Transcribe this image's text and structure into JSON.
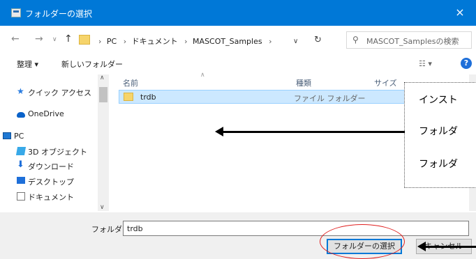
{
  "window": {
    "title": "フォルダーの選択",
    "close_label": "×"
  },
  "address": {
    "crumbs": [
      "PC",
      "ドキュメント",
      "MASCOT_Samples"
    ],
    "dropdown_glyph": "∨",
    "refresh_glyph": "↻",
    "search_placeholder": "MASCOT_Samplesの検索"
  },
  "nav_buttons": {
    "back": "←",
    "forward": "→",
    "recent": "∨",
    "up": "↑"
  },
  "commands": {
    "organize": "整理 ▾",
    "new_folder": "新しいフォルダー",
    "view": "☷ ▾",
    "help": "?"
  },
  "sidebar": {
    "items": [
      {
        "label": "クイック アクセス",
        "icon": "star-icon"
      },
      {
        "label": "OneDrive",
        "icon": "cloud-icon"
      },
      {
        "label": "PC",
        "icon": "computer-icon"
      },
      {
        "label": "3D オブジェクト",
        "icon": "cube-icon"
      },
      {
        "label": "ダウンロード",
        "icon": "download-icon"
      },
      {
        "label": "デスクトップ",
        "icon": "desktop-icon"
      },
      {
        "label": "ドキュメント",
        "icon": "document-icon"
      }
    ]
  },
  "columns": {
    "name": "名前",
    "type": "種類",
    "size": "サイズ"
  },
  "files": [
    {
      "name": "trdb",
      "type": "ファイル フォルダー"
    }
  ],
  "callout": {
    "lines": [
      "インスト",
      "フォルダ",
      "フォルダ"
    ]
  },
  "footer": {
    "folder_label": "フォルダー:",
    "folder_value": "trdb",
    "select_button": "フォルダーの選択",
    "cancel_button": "キャンセル"
  },
  "colors": {
    "titlebar": "#0078d7",
    "selection": "#cce8ff",
    "highlight_ellipse": "#e02020"
  }
}
